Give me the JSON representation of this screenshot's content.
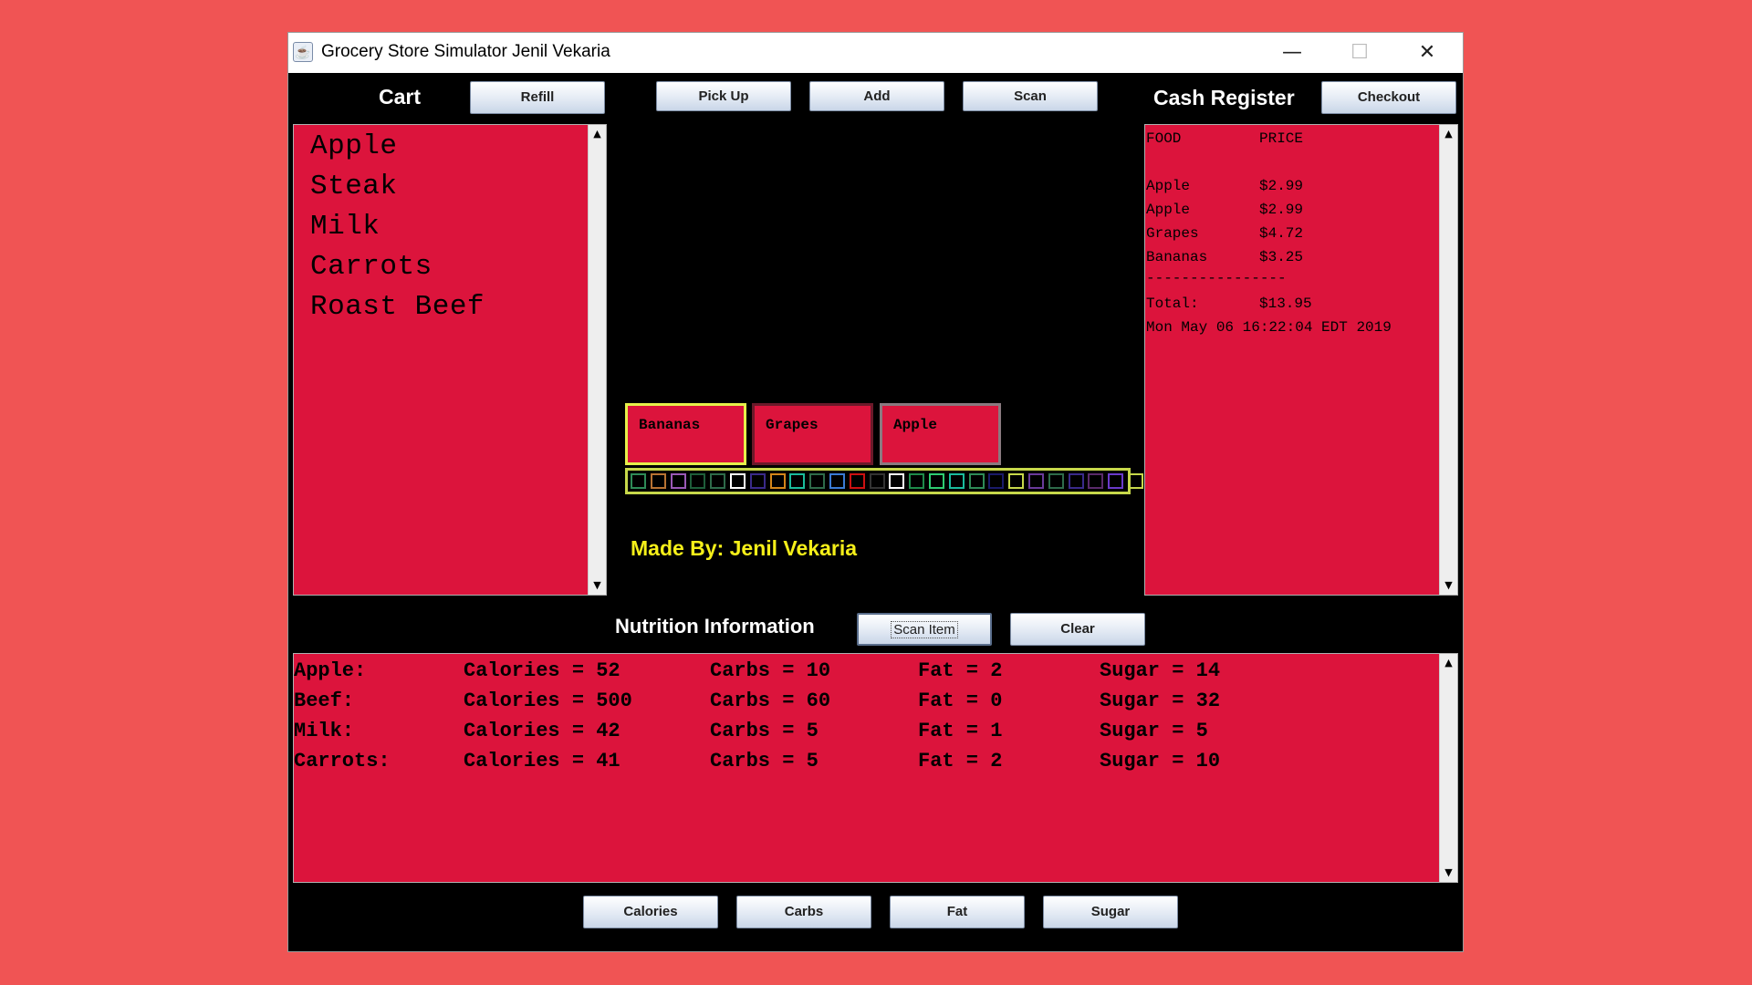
{
  "window": {
    "title": "Grocery Store Simulator Jenil Vekaria"
  },
  "cart": {
    "title": "Cart",
    "refill_label": "Refill",
    "items": [
      "Apple",
      "Steak",
      "Milk",
      "Carrots",
      "Roast Beef"
    ]
  },
  "actions": {
    "pick_up": "Pick Up",
    "add": "Add",
    "scan": "Scan"
  },
  "register": {
    "title": "Cash Register",
    "checkout_label": "Checkout",
    "header": {
      "food": "FOOD",
      "price": "PRICE"
    },
    "lines": [
      {
        "food": "Apple",
        "price": "$2.99"
      },
      {
        "food": "Apple",
        "price": "$2.99"
      },
      {
        "food": "Grapes",
        "price": "$4.72"
      },
      {
        "food": "Bananas",
        "price": "$3.25"
      }
    ],
    "separator": "----------------",
    "total_label": "Total:",
    "total_value": "$13.95",
    "timestamp": "Mon May 06 16:22:04 EDT 2019"
  },
  "conveyor": {
    "items": [
      {
        "name": "Bananas",
        "border": "#e6f04a"
      },
      {
        "name": "Grapes",
        "border": "#6b1a2a"
      },
      {
        "name": "Apple",
        "border": "#8a7a80"
      }
    ],
    "cell_colors": [
      "#2e8b57",
      "#b87333",
      "#9b59b6",
      "#1e5e3a",
      "#2e6b4a",
      "#ffffff",
      "#3a2a8a",
      "#d4861a",
      "#1abc9c",
      "#2e6b4a",
      "#3a7bd5",
      "#cc1111",
      "#333333",
      "#ffffff",
      "#1e8b4a",
      "#2ecc71",
      "#1abc9c",
      "#2e8b57",
      "#1a1a6a",
      "#c7d84a",
      "#6a3a9a",
      "#2e6b4a",
      "#3a2a8a",
      "#5a2a6a",
      "#6a3aca",
      "#c7d84a"
    ]
  },
  "credit": "Made By: Jenil Vekaria",
  "nutrition": {
    "title": "Nutrition Information",
    "scan_item_label": "Scan Item",
    "clear_label": "Clear",
    "rows": [
      {
        "name": "Apple:",
        "calories": "Calories = 52",
        "carbs": "Carbs = 10",
        "fat": "Fat = 2",
        "sugar": "Sugar = 14"
      },
      {
        "name": "Beef:",
        "calories": "Calories = 500",
        "carbs": "Carbs = 60",
        "fat": "Fat = 0",
        "sugar": "Sugar = 32"
      },
      {
        "name": "Milk:",
        "calories": "Calories = 42",
        "carbs": "Carbs = 5",
        "fat": "Fat = 1",
        "sugar": "Sugar = 5"
      },
      {
        "name": "Carrots:",
        "calories": "Calories = 41",
        "carbs": "Carbs = 5",
        "fat": "Fat = 2",
        "sugar": "Sugar = 10"
      }
    ]
  },
  "sort_buttons": {
    "calories": "Calories",
    "carbs": "Carbs",
    "fat": "Fat",
    "sugar": "Sugar"
  },
  "colors": {
    "panel_red": "#dc143c",
    "background": "#f05454",
    "credit_yellow": "#f5ef19"
  }
}
